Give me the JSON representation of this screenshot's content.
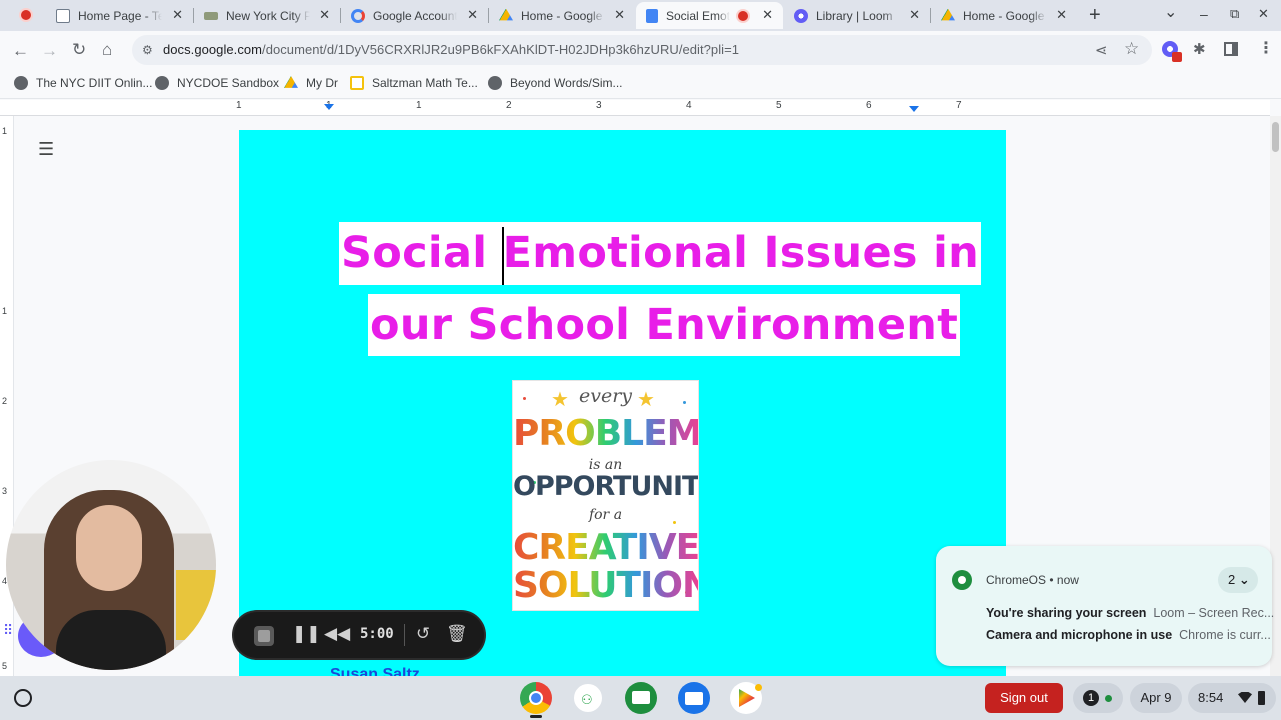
{
  "tabs": [
    {
      "label": "Home Page - Te",
      "fav": "#6f7b8a",
      "close": "✕"
    },
    {
      "label": "New York City P",
      "fav": "#8f9a7a",
      "close": "✕"
    },
    {
      "label": "Google Account",
      "fav": "#4285f4",
      "close": "✕"
    },
    {
      "label": "Home - Google D",
      "fav": "#0f9d58",
      "close": "✕"
    },
    {
      "label": "Social Emot",
      "fav": "#4285f4",
      "close": "✕"
    },
    {
      "label": "Library | Loom",
      "fav": "#625df5",
      "close": "✕"
    },
    {
      "label": "Home - Google D",
      "fav": "#0f9d58",
      "close": "✕"
    }
  ],
  "window_controls": {
    "new_tab": "+",
    "dropdown": "⌄",
    "minimize": "–",
    "maximize": "⧉",
    "close": "✕"
  },
  "address": {
    "host": "docs.google.com",
    "path": "/document/d/1DyV56CRXRlJR2u9PB6kFXAhKlDT-H02JDHp3k6hzURU/edit?pli=1"
  },
  "bookmarks": [
    {
      "label": "The NYC DIIT Onlin...",
      "fav": "#5f6368"
    },
    {
      "label": "NYCDOE Sandbox",
      "fav": "#5f6368"
    },
    {
      "label": "My Dr",
      "fav": "#fbbc04"
    },
    {
      "label": "Saltzman Math Te...",
      "fav": "#f4c20d"
    },
    {
      "label": "Beyond Words/Sim...",
      "fav": "#5f6368"
    }
  ],
  "ruler": {
    "h": [
      "1",
      "1",
      "1",
      "2",
      "3",
      "4",
      "5",
      "6",
      "7"
    ],
    "v": [
      "1",
      "1",
      "2",
      "3",
      "4",
      "5"
    ]
  },
  "document": {
    "title_line1_a": "Social ",
    "title_line1_b": "Emotional Issues in",
    "title_line2": "our School Environment",
    "footer_partial": "Susan Saltz..."
  },
  "poster": {
    "every": "every",
    "problem": "PROBLEM",
    "is_an": "is an",
    "opportunity": "OPPORTUNITY",
    "for_a": "for a",
    "creative": "CREATIVE",
    "solution": "SOLUTION"
  },
  "loom": {
    "timer": "5:00"
  },
  "notification": {
    "app": "ChromeOS",
    "time": "now",
    "count": "2",
    "row1_title": "You're sharing your screen",
    "row1_detail": "Loom – Screen Rec...",
    "row2_title": "Camera and microphone in use",
    "row2_detail": "Chrome is curr..."
  },
  "shelf": {
    "sign_out": "Sign out",
    "notif_count": "1",
    "date": "Apr 9",
    "time": "8:54"
  },
  "colors": {
    "page_bg": "#00ffff",
    "title": "#e81ee8",
    "accent": "#1a73e8"
  }
}
